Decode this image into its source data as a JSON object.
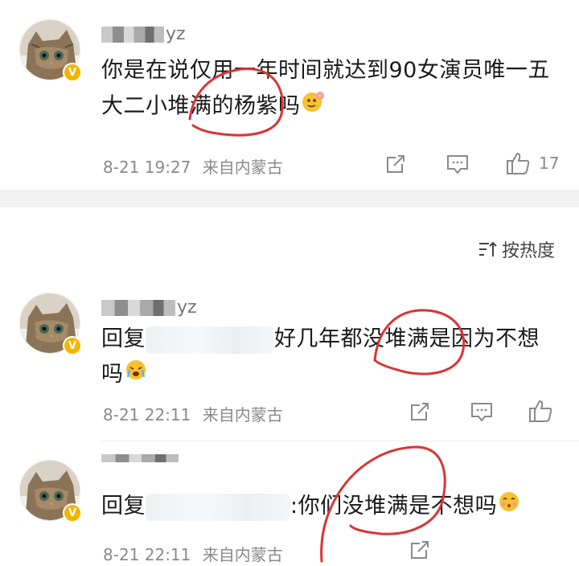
{
  "comments": [
    {
      "username": "yz",
      "content": "你是在说仅用一年时间就达到90女演员唯一五大二小堆满的杨紫吗",
      "time": "8-21 19:27",
      "source": "来自内蒙古",
      "likes": "17"
    },
    {
      "username": "yz",
      "reply_prefix": "回复",
      "content_after": "好几年都没堆满是因为不想吗",
      "time": "8-21 22:11",
      "source": "来自内蒙古"
    },
    {
      "username": "yz",
      "reply_prefix": "回复",
      "content_after": ":你们没堆满是不想吗",
      "time": "8-21 22:11",
      "source": "来自内蒙古"
    }
  ],
  "sort": {
    "label": "按热度",
    "icon": "sort-icon"
  },
  "icons": {
    "verified": "verified-badge-icon",
    "share": "share-icon",
    "comment": "comment-icon",
    "like": "thumbs-up-icon"
  },
  "colors": {
    "verified": "#f5b400",
    "annotation": "#d93434",
    "meta": "#8a8a8a"
  }
}
